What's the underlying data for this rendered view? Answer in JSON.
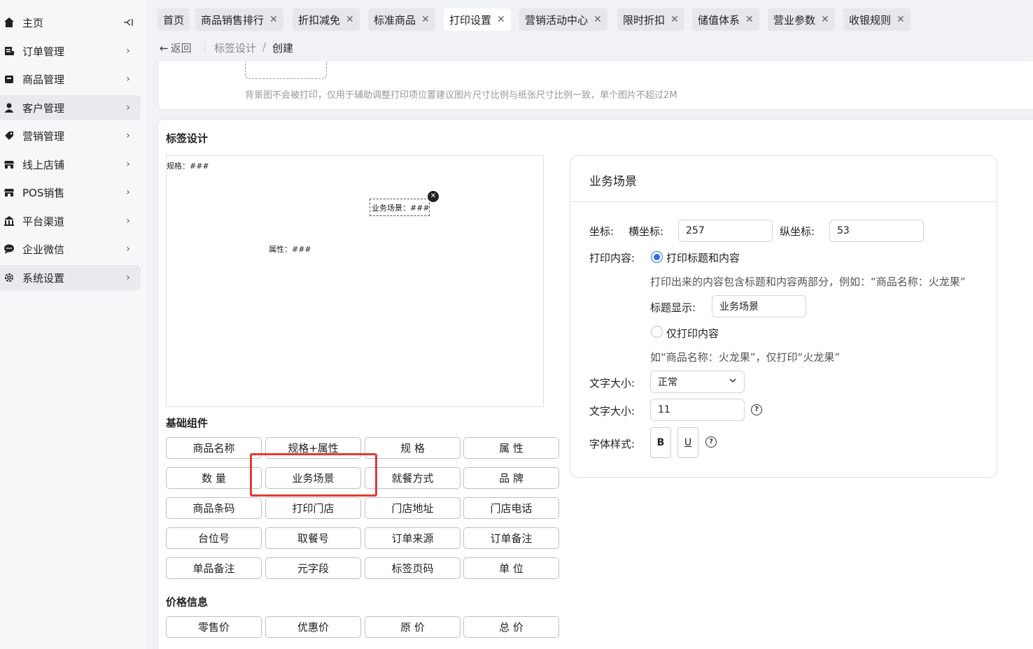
{
  "sidebar": {
    "collapse_icon": "collapse-left-icon",
    "items": [
      {
        "label": "主页",
        "icon": "home-icon"
      },
      {
        "label": "订单管理",
        "icon": "order-icon"
      },
      {
        "label": "商品管理",
        "icon": "product-icon"
      },
      {
        "label": "客户管理",
        "icon": "user-icon"
      },
      {
        "label": "营销管理",
        "icon": "tag-icon"
      },
      {
        "label": "线上店铺",
        "icon": "store-icon"
      },
      {
        "label": "POS销售",
        "icon": "pos-icon"
      },
      {
        "label": "平台渠道",
        "icon": "bank-icon"
      },
      {
        "label": "企业微信",
        "icon": "chat-icon"
      },
      {
        "label": "系统设置",
        "icon": "gear-icon"
      }
    ]
  },
  "tabs": [
    {
      "label": "首页"
    },
    {
      "label": "商品销售排行"
    },
    {
      "label": "折扣减免"
    },
    {
      "label": "标准商品"
    },
    {
      "label": "打印设置"
    },
    {
      "label": "营销活动中心"
    },
    {
      "label": "限时折扣"
    },
    {
      "label": "储值体系"
    },
    {
      "label": "营业参数"
    },
    {
      "label": "收银规则"
    }
  ],
  "breadcrumb": {
    "back": "返回",
    "parent": "标签设计",
    "sep": "/",
    "current": "创建"
  },
  "bg_note": "背景图不会被打印，仅用于辅助调整打印项位置建议图片尺寸比例与纸张尺寸比例一致，单个图片不超过2M",
  "label_design": {
    "title": "标签设计",
    "canvas": {
      "spec": "规格：###",
      "scene": "业务场景：###",
      "attr": "属性：###"
    }
  },
  "basic": {
    "title": "基础组件",
    "buttons": [
      "商品名称",
      "规格+属性",
      "规 格",
      "属 性",
      "数 量",
      "业务场景",
      "就餐方式",
      "品 牌",
      "商品条码",
      "打印门店",
      "门店地址",
      "门店电话",
      "台位号",
      "取餐号",
      "订单来源",
      "订单备注",
      "单品备注",
      "元字段",
      "标签页码",
      "单 位"
    ]
  },
  "price": {
    "title": "价格信息",
    "buttons": [
      "零售价",
      "优惠价",
      "原 价",
      "总 价"
    ]
  },
  "props": {
    "title": "业务场景",
    "coord_label": "坐标:",
    "x_label": "横坐标:",
    "x_value": "257",
    "y_label": "纵坐标:",
    "y_value": "53",
    "content_label": "打印内容:",
    "opt1": "打印标题和内容",
    "opt1_hint": "打印出来的内容包含标题和内容两部分，例如：“商品名称：火龙果”",
    "title_show_label": "标题显示:",
    "title_show_value": "业务场景",
    "opt2": "仅打印内容",
    "opt2_hint": "如“商品名称：火龙果”，仅打印“火龙果”",
    "size_label": "文字大小:",
    "size_value": "正常",
    "size2_label": "文字大小:",
    "size2_value": "11",
    "style_label": "字体样式:",
    "bold": "B",
    "underline": "U"
  }
}
